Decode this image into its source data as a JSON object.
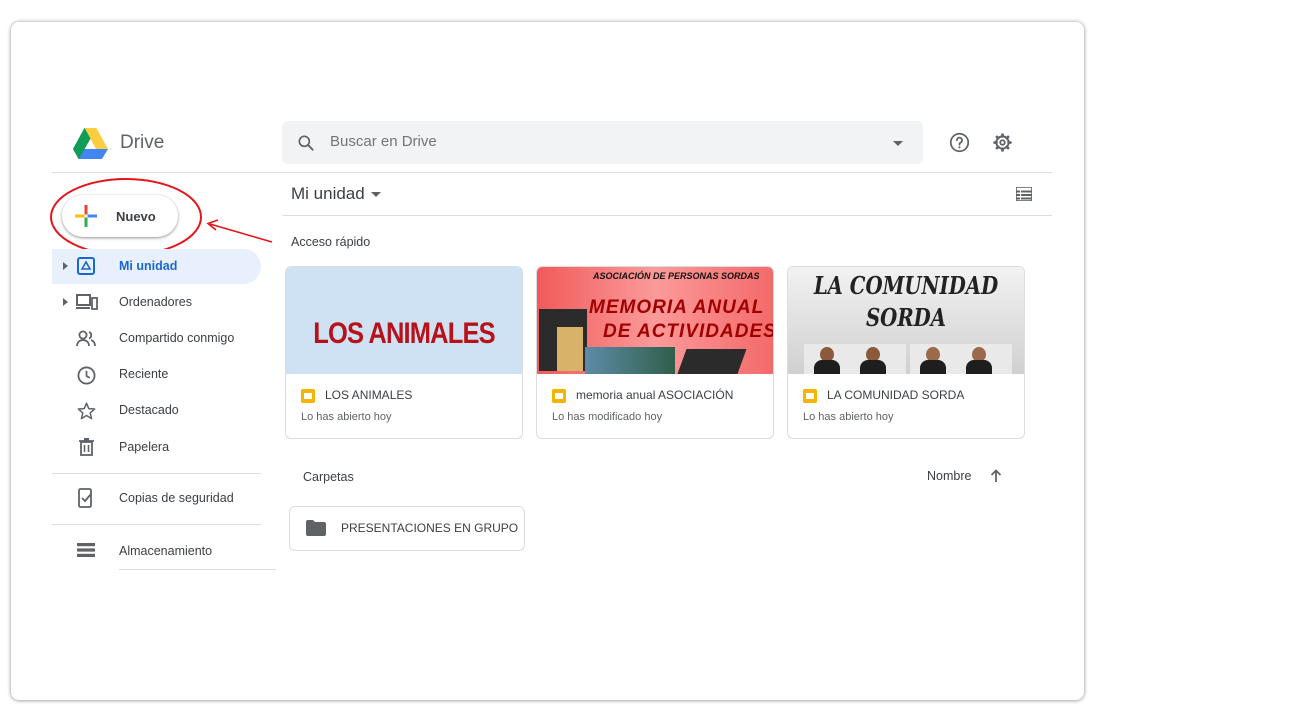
{
  "app": {
    "name": "Drive"
  },
  "search": {
    "placeholder": "Buscar en Drive"
  },
  "new_button": {
    "label": "Nuevo"
  },
  "sidebar": {
    "items": [
      {
        "label": "Mi unidad",
        "icon": "my-drive-icon",
        "active": true
      },
      {
        "label": "Ordenadores",
        "icon": "computers-icon"
      },
      {
        "label": "Compartido conmigo",
        "icon": "shared-icon"
      },
      {
        "label": "Reciente",
        "icon": "clock-icon"
      },
      {
        "label": "Destacado",
        "icon": "star-icon"
      },
      {
        "label": "Papelera",
        "icon": "trash-icon"
      },
      {
        "label": "Copias de seguridad",
        "icon": "backup-icon"
      },
      {
        "label": "Almacenamiento",
        "icon": "storage-icon"
      }
    ]
  },
  "main": {
    "location": "Mi unidad",
    "quick_access_title": "Acceso rápido",
    "cards": [
      {
        "thumb_text": "LOS ANIMALES",
        "title": "LOS ANIMALES",
        "subtitle": "Lo has abierto hoy"
      },
      {
        "thumb_line1": "ASOCIACIÓN DE PERSONAS SORDAS",
        "thumb_line2": "MEMORIA ANUAL",
        "thumb_line3": "DE ACTIVIDADES",
        "title": "memoria anual ASOCIACIÓN",
        "subtitle": "Lo has modificado hoy"
      },
      {
        "thumb_line1": "LA COMUNIDAD",
        "thumb_line2": "SORDA",
        "title": "LA COMUNIDAD SORDA",
        "subtitle": "Lo has abierto hoy"
      }
    ],
    "folders_title": "Carpetas",
    "sort_label": "Nombre",
    "folders": [
      {
        "name": "PRESENTACIONES EN GRUPO"
      }
    ]
  },
  "colors": {
    "accent": "#1967d2",
    "active_bg": "#e8f0fe",
    "annotation": "#e3161b",
    "slides_yellow": "#f4b400"
  }
}
